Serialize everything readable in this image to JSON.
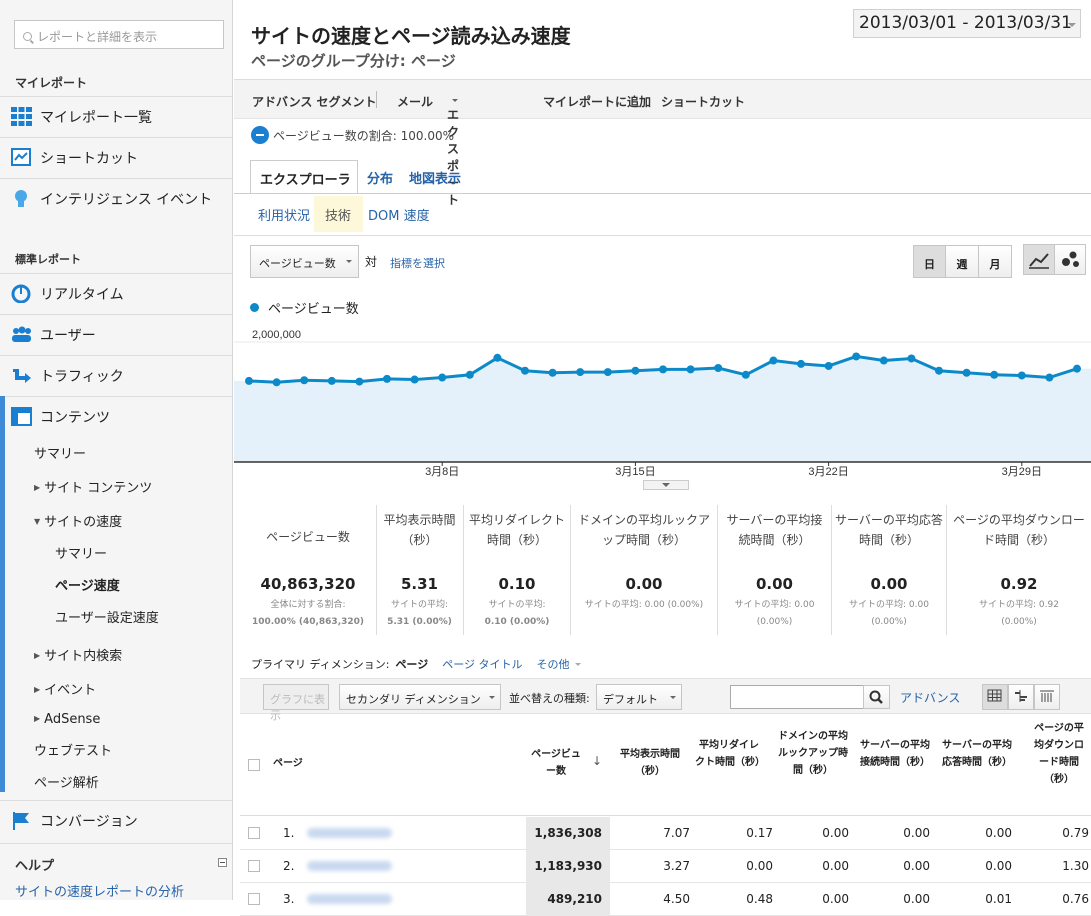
{
  "sidebar": {
    "search_placeholder": "レポートと詳細を表示",
    "my_reports_heading": "マイレポート",
    "my_reports": [
      {
        "label": "マイレポート一覧",
        "icon": "grid-icon"
      },
      {
        "label": "ショートカット",
        "icon": "shortcut-icon"
      },
      {
        "label": "インテリジェンス イベント",
        "icon": "lightbulb-icon"
      }
    ],
    "standard_heading": "標準レポート",
    "standard": [
      {
        "label": "リアルタイム",
        "icon": "realtime-icon"
      },
      {
        "label": "ユーザー",
        "icon": "users-icon"
      },
      {
        "label": "トラフィック",
        "icon": "traffic-icon"
      },
      {
        "label": "コンテンツ",
        "icon": "content-icon"
      }
    ],
    "content_sub": {
      "summary": "サマリー",
      "site_content": "サイト コンテンツ",
      "site_speed": "サイトの速度",
      "speed_summary": "サマリー",
      "page_speed": "ページ速度",
      "user_timing": "ユーザー設定速度",
      "site_search": "サイト内検索",
      "events": "イベント",
      "adsense": "AdSense",
      "web_test": "ウェブテスト",
      "page_analytics": "ページ解析"
    },
    "conversion": {
      "label": "コンバージョン",
      "icon": "flag-icon"
    },
    "help_heading": "ヘルプ",
    "help_link": "サイトの速度レポートの分析"
  },
  "header": {
    "title": "サイトの速度とページ読み込み速度",
    "subtitle": "ページのグループ分け: ページ",
    "date_range": "2013/03/01 - 2013/03/31"
  },
  "toolbar": {
    "advanced_segment": "アドバンス セグメント",
    "email": "メール",
    "export": "エクスポート",
    "add_dashboard": "マイレポートに追加",
    "shortcut": "ショートカット"
  },
  "pageview_pct": "ページビュー数の割合: 100.00%",
  "tabs": {
    "explorer": "エクスプローラ",
    "distribution": "分布",
    "map": "地図表示"
  },
  "subtabs": {
    "usage": "利用状況",
    "tech": "技術",
    "dom": "DOM 速度"
  },
  "metric_controls": {
    "selected_metric": "ページビュー数",
    "vs": "対",
    "pick_metric": "指標を選択",
    "day": "日",
    "week": "週",
    "month": "月"
  },
  "chart_data": {
    "type": "area",
    "series": [
      {
        "name": "ページビュー数",
        "values": [
          1310000,
          1290000,
          1320000,
          1310000,
          1300000,
          1340000,
          1330000,
          1360000,
          1400000,
          1650000,
          1460000,
          1430000,
          1440000,
          1440000,
          1460000,
          1480000,
          1480000,
          1500000,
          1400000,
          1610000,
          1560000,
          1530000,
          1670000,
          1610000,
          1640000,
          1460000,
          1430000,
          1400000,
          1390000,
          1360000,
          1490000
        ]
      }
    ],
    "x_tick_labels": [
      "3月8日",
      "3月15日",
      "3月22日",
      "3月29日"
    ],
    "y_tick_labels": [
      "2,000,000",
      "1,000,000"
    ],
    "ylim": [
      0,
      2000000
    ],
    "color": "#0c89c9",
    "fill": "#e4f1fb"
  },
  "stats": [
    {
      "label": "ページビュー数",
      "value": "40,863,320",
      "foot1": "全体に対する割合:",
      "foot2": "100.00% (40,863,320)",
      "foot_bold": true
    },
    {
      "label": "平均表示時間（秒）",
      "value": "5.31",
      "foot1": "サイトの平均:",
      "foot2": "5.31 (0.00%)",
      "foot_bold": true
    },
    {
      "label": "平均リダイレクト時間（秒）",
      "value": "0.10",
      "foot1": "サイトの平均:",
      "foot2": "0.10 (0.00%)",
      "foot_bold": true
    },
    {
      "label": "ドメインの平均ルックアップ時間（秒）",
      "value": "0.00",
      "foot1": "サイトの平均: 0.00 (0.00%)",
      "foot2": "",
      "foot_bold": false
    },
    {
      "label": "サーバーの平均接続時間（秒）",
      "value": "0.00",
      "foot1": "サイトの平均: 0.00",
      "foot2": "(0.00%)",
      "foot_bold": false
    },
    {
      "label": "サーバーの平均応答時間（秒）",
      "value": "0.00",
      "foot1": "サイトの平均: 0.00",
      "foot2": "(0.00%)",
      "foot_bold": false
    },
    {
      "label": "ページの平均ダウンロード時間（秒）",
      "value": "0.92",
      "foot1": "サイトの平均: 0.92",
      "foot2": "(0.00%)",
      "foot_bold": false
    }
  ],
  "dimension": {
    "label": "プライマリ ディメンション:",
    "current": "ページ",
    "alt": "ページ タイトル",
    "other": "その他"
  },
  "table_toolbar": {
    "graph": "グラフに表示",
    "secondary": "セカンダリ ディメンション",
    "sort_label": "並べ替えの種類:",
    "sort_value": "デフォルト",
    "advanced": "アドバンス"
  },
  "table": {
    "headers": [
      "ページ",
      "ページビュー数",
      "平均表示時間（秒）",
      "平均リダイレクト時間（秒）",
      "ドメインの平均ルックアップ時間（秒）",
      "サーバーの平均接続時間（秒）",
      "サーバーの平均応答時間（秒）",
      "ページの平均ダウンロード時間（秒）"
    ],
    "rows": [
      {
        "idx": "1.",
        "pv": "1,836,308",
        "c": [
          "7.07",
          "0.17",
          "0.00",
          "0.00",
          "0.00",
          "0.79"
        ]
      },
      {
        "idx": "2.",
        "pv": "1,183,930",
        "c": [
          "3.27",
          "0.00",
          "0.00",
          "0.00",
          "0.00",
          "1.30"
        ]
      },
      {
        "idx": "3.",
        "pv": "489,210",
        "c": [
          "4.50",
          "0.48",
          "0.00",
          "0.00",
          "0.01",
          "0.76"
        ]
      }
    ]
  }
}
